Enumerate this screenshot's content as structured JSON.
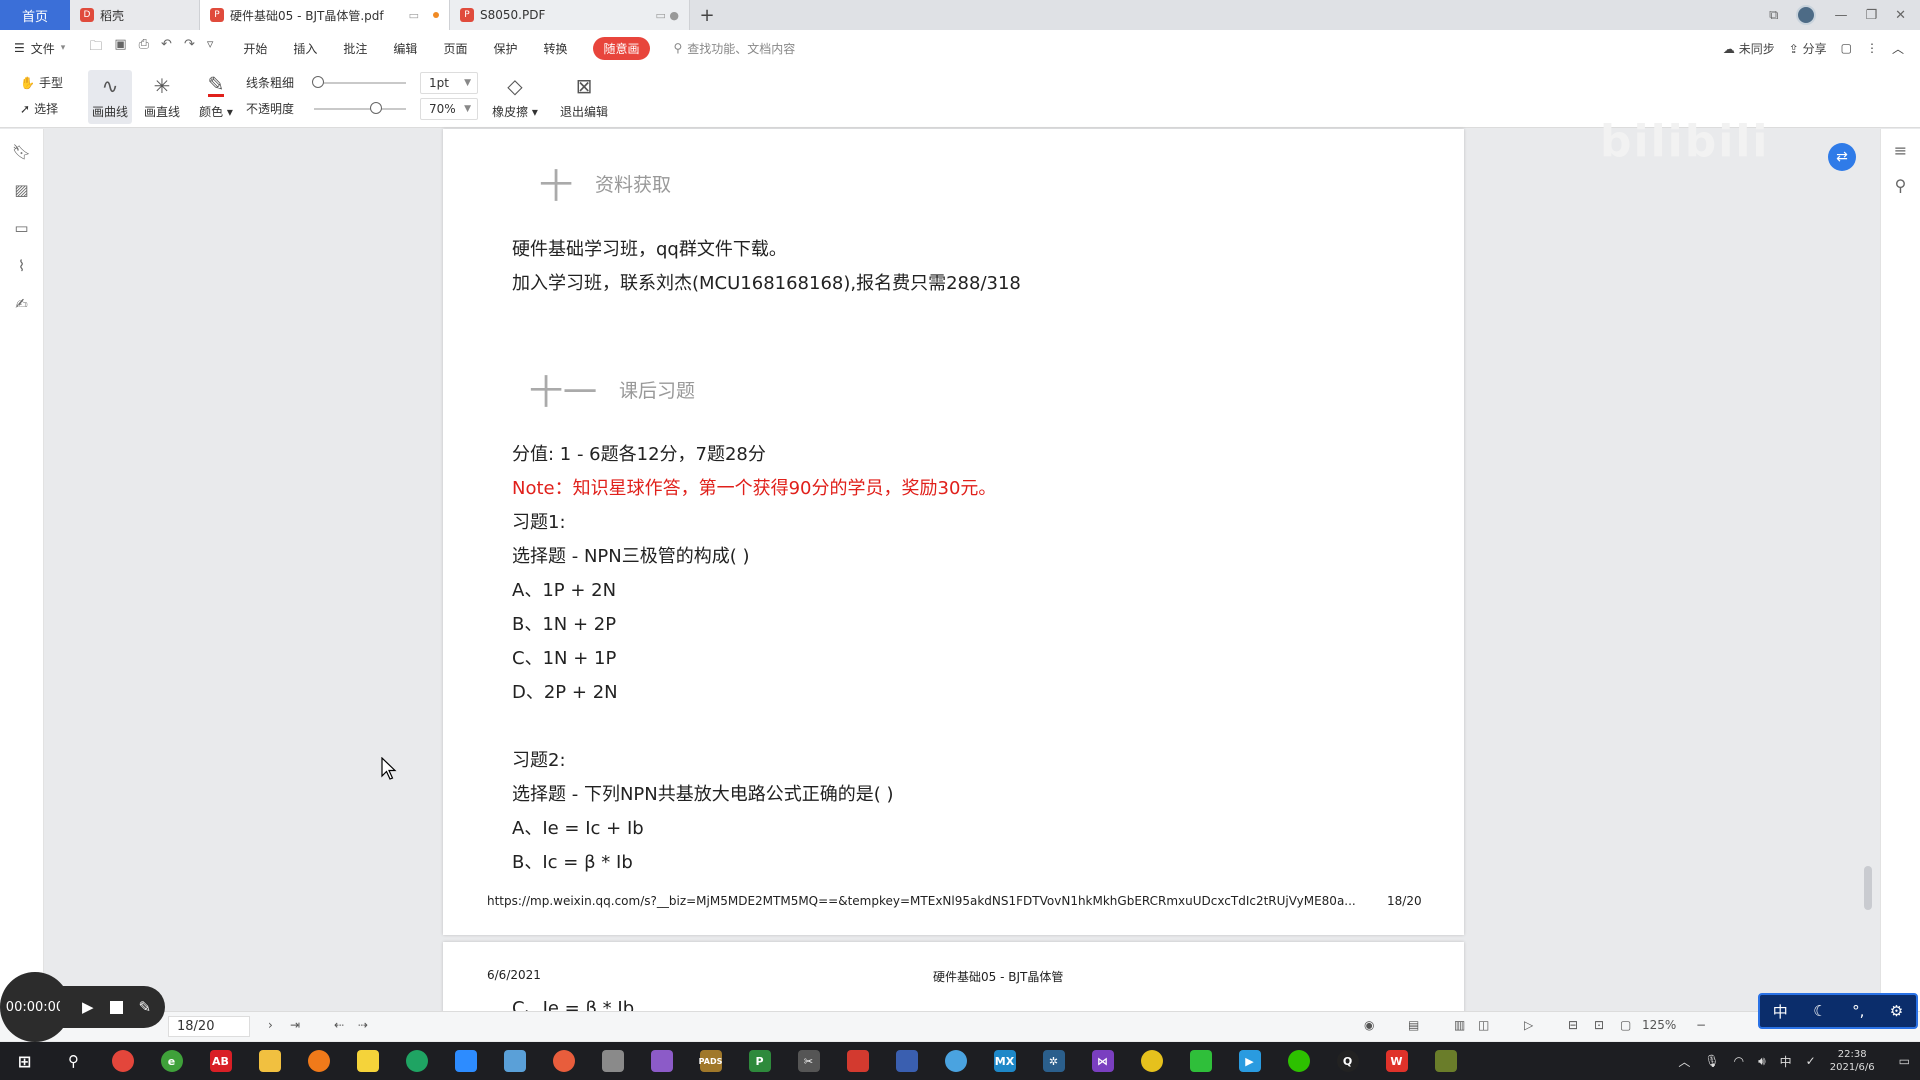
{
  "tabs": {
    "home": "首页",
    "docer": "稻壳",
    "active_doc": "硬件基础05 - BJT晶体管.pdf",
    "other_doc": "S8050.PDF"
  },
  "menu": {
    "file": "文件",
    "items": [
      "开始",
      "插入",
      "批注",
      "编辑",
      "页面",
      "保护",
      "转换"
    ],
    "highlight": "随意画",
    "search_placeholder": "查找功能、文档内容",
    "sync": "未同步",
    "share": "分享"
  },
  "ribbon": {
    "hand": "手型",
    "select": "选择",
    "draw_curve": "画曲线",
    "draw_line": "画直线",
    "color": "颜色",
    "line_width_label": "线条粗细",
    "line_width_value": "1pt",
    "opacity_label": "不透明度",
    "opacity_value": "70%",
    "eraser": "橡皮擦",
    "exit_edit": "退出编辑",
    "watermark": "bilibili"
  },
  "doc": {
    "section10_num": "十",
    "section10_title": "资料获取",
    "para1": "硬件基础学习班，qq群文件下载。",
    "para2": "加入学习班，联系刘杰(MCU168168168),报名费只需288/318",
    "section11_num": "十一",
    "section11_title": "课后习题",
    "score": "分值: 1 - 6题各12分，7题28分",
    "note": "Note：知识星球作答，第一个获得90分的学员，奖励30元。",
    "q1_title": "习题1:",
    "q1_stem": "选择题 - NPN三极管的构成( )",
    "q1_a": "A、1P + 2N",
    "q1_b": "B、1N + 2P",
    "q1_c": "C、1N + 1P",
    "q1_d": "D、2P + 2N",
    "q2_title": "习题2:",
    "q2_stem": "选择题 - 下列NPN共基放大电路公式正确的是( )",
    "q2_a": "A、Ie = Ic + Ib",
    "q2_b": "B、Ic =  β * Ib",
    "footer_url": "https://mp.weixin.qq.com/s?__biz=MjM5MDE2MTM5MQ==&tempkey=MTExNl95akdNS1FDTVovN1hkMkhGbERCRmxuUDcxcTdIc2tRUjVyME80a...",
    "footer_page": "18/20",
    "next_date": "6/6/2021",
    "next_title": "硬件基础05 - BJT晶体管",
    "next_cut": "C、Ie =  β * Ib"
  },
  "status": {
    "page_input": "18/20",
    "zoom": "125%"
  },
  "recorder": {
    "time": "00:00:00"
  },
  "ime": {
    "lang": "中"
  },
  "taskbar": {
    "tray_lang": "中",
    "time": "22:38",
    "date": "2021/6/6"
  }
}
